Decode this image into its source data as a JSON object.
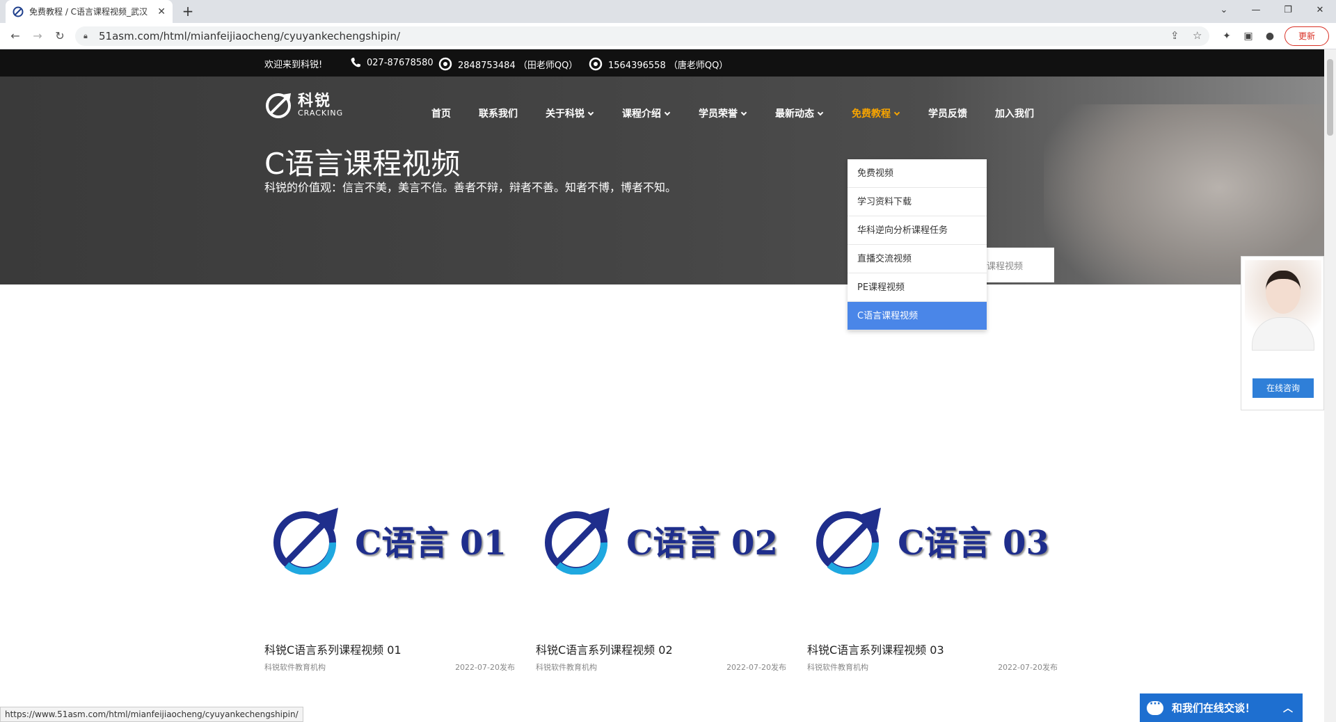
{
  "browser": {
    "tab_title": "免费教程 / C语言课程视频_武汉",
    "url": "51asm.com/html/mianfeijiaocheng/cyuyankechengshipin/",
    "update_label": "更新",
    "status_url": "https://www.51asm.com/html/mianfeijiaocheng/cyuyankechengshipin/"
  },
  "topbar": {
    "welcome": "欢迎来到科锐!",
    "phone": "027-87678580",
    "qq1": "2848753484 （田老师QQ）",
    "qq2": "1564396558 （唐老师QQ）"
  },
  "logo": {
    "cn": "科锐",
    "en": "CRACKING"
  },
  "nav": [
    {
      "label": "首页"
    },
    {
      "label": "联系我们"
    },
    {
      "label": "关于科锐"
    },
    {
      "label": "课程介绍"
    },
    {
      "label": "学员荣誉"
    },
    {
      "label": "最新动态"
    },
    {
      "label": "免费教程"
    },
    {
      "label": "学员反馈"
    },
    {
      "label": "加入我们"
    }
  ],
  "hero": {
    "title": "C语言课程视频",
    "subtitle": "科锐的价值观：信言不美，美言不信。善者不辩，辩者不善。知者不博，博者不知。"
  },
  "dropdown": [
    {
      "label": "免费视频"
    },
    {
      "label": "学习资料下载"
    },
    {
      "label": "华科逆向分析课程任务"
    },
    {
      "label": "直播交流视频"
    },
    {
      "label": "PE课程视频"
    },
    {
      "label": "C语言课程视频"
    }
  ],
  "breadcrumb_fragment": "课程视频",
  "cards": [
    {
      "thumb_label": "C语言 01",
      "title": "科锐C语言系列课程视频 01",
      "org": "科锐软件教育机构",
      "date": "2022-07-20发布"
    },
    {
      "thumb_label": "C语言 02",
      "title": "科锐C语言系列课程视频 02",
      "org": "科锐软件教育机构",
      "date": "2022-07-20发布"
    },
    {
      "thumb_label": "C语言 03",
      "title": "科锐C语言系列课程视频 03",
      "org": "科锐软件教育机构",
      "date": "2022-07-20发布"
    }
  ],
  "side_widget": {
    "consult_label": "在线咨询"
  },
  "chat": {
    "label": "和我们在线交谈！"
  },
  "colors": {
    "nav_active": "#f7a400",
    "dropdown_active": "#4a86e8",
    "chat_bg": "#1e6fd0"
  }
}
